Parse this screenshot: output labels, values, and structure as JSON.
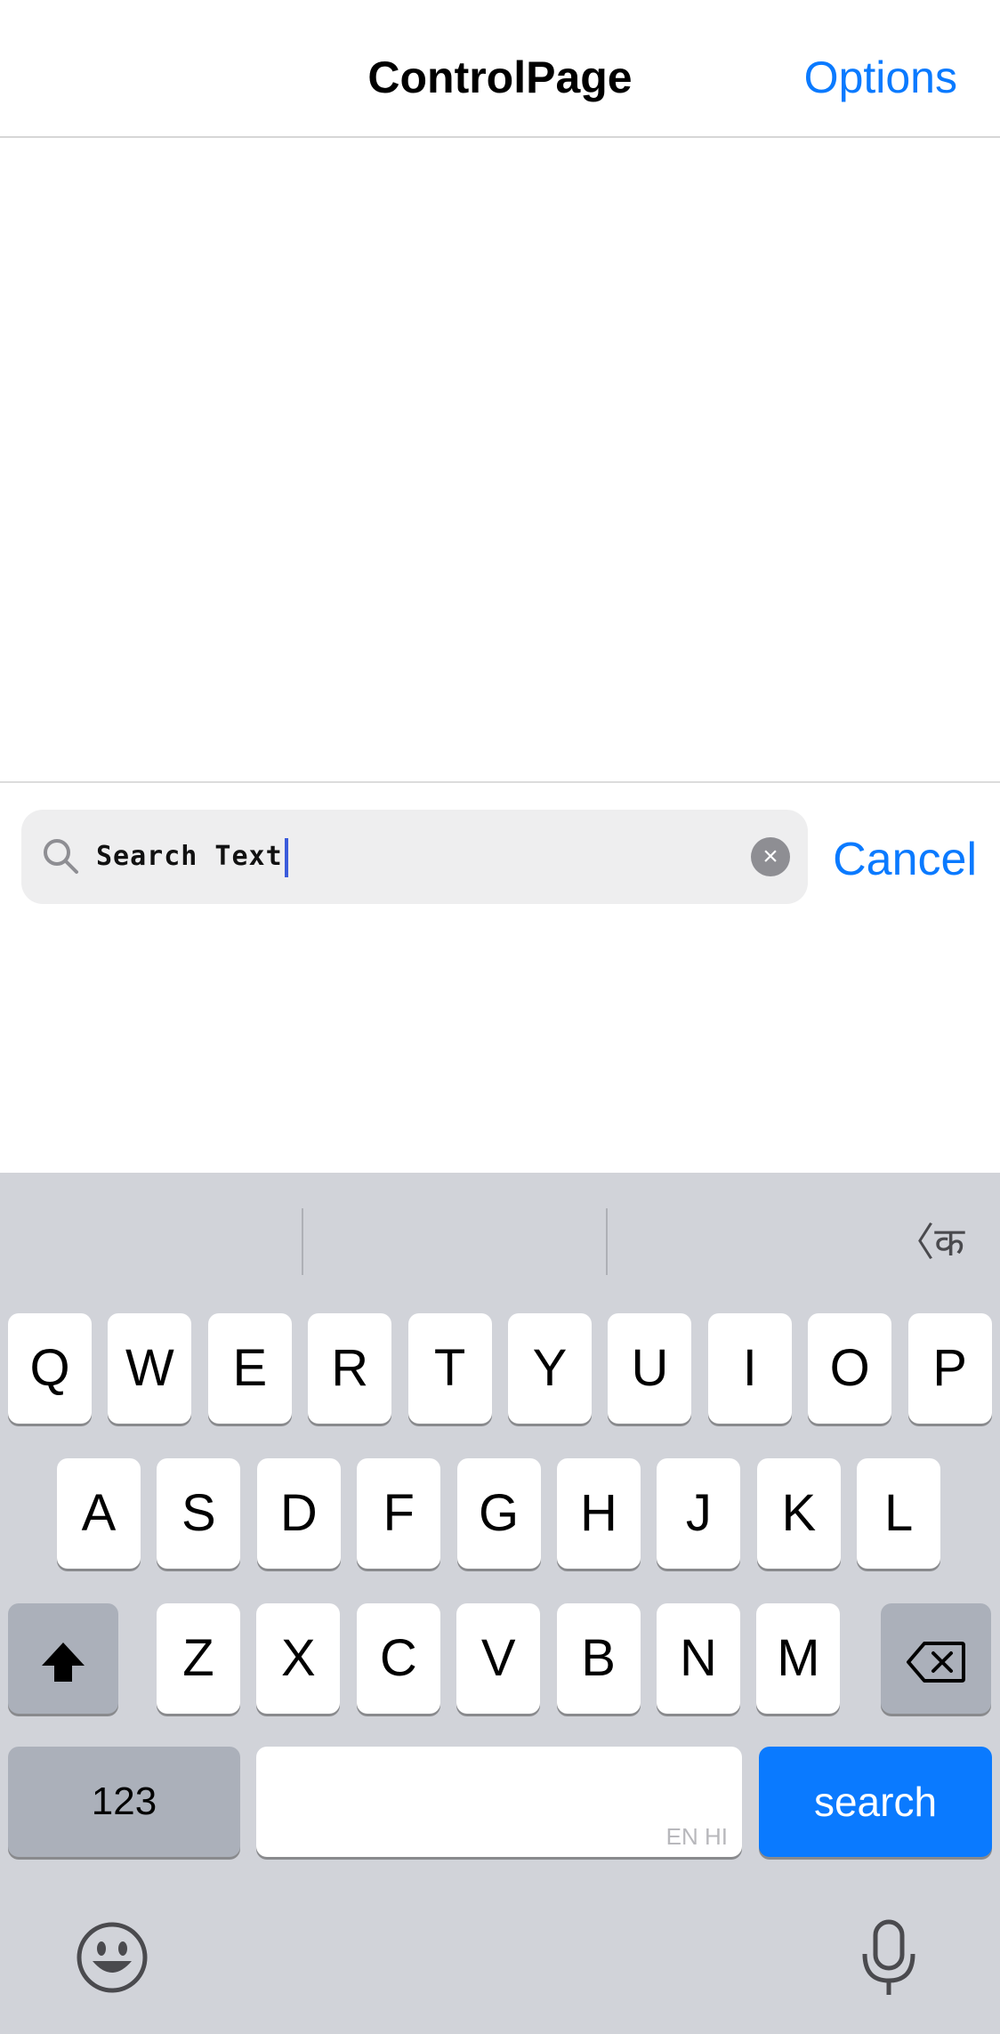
{
  "nav": {
    "title": "ControlPage",
    "options_label": "Options"
  },
  "search": {
    "value": "Search Text",
    "cancel_label": "Cancel"
  },
  "keyboard": {
    "lang_switch": "〈क",
    "row1": [
      "Q",
      "W",
      "E",
      "R",
      "T",
      "Y",
      "U",
      "I",
      "O",
      "P"
    ],
    "row2": [
      "A",
      "S",
      "D",
      "F",
      "G",
      "H",
      "J",
      "K",
      "L"
    ],
    "row3": [
      "Z",
      "X",
      "C",
      "V",
      "B",
      "N",
      "M"
    ],
    "numbers_label": "123",
    "space_hint": "EN HI",
    "search_label": "search",
    "icons": {
      "shift": "shift-icon",
      "backspace": "backspace-icon",
      "emoji": "emoji-icon",
      "mic": "microphone-icon"
    }
  },
  "colors": {
    "accent": "#0a7aff",
    "keyboard_bg": "#d1d3d9",
    "dark_key": "#abb0ba"
  }
}
